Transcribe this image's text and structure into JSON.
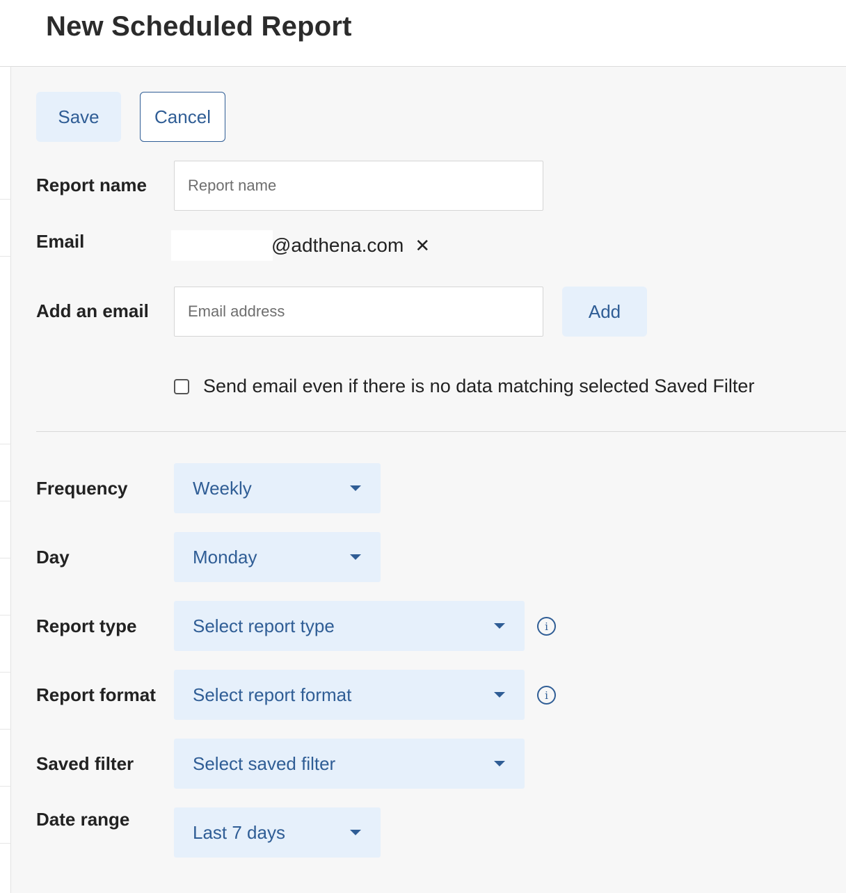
{
  "header": {
    "title": "New Scheduled Report"
  },
  "actions": {
    "save_label": "Save",
    "cancel_label": "Cancel"
  },
  "form": {
    "report_name": {
      "label": "Report name",
      "value": "",
      "placeholder": "Report name"
    },
    "email": {
      "label": "Email",
      "recipient_domain": "@adthena.com",
      "remove_glyph": "✕"
    },
    "add_email": {
      "label": "Add an email",
      "value": "",
      "placeholder": "Email address",
      "button_label": "Add"
    },
    "send_empty": {
      "label": "Send email even if there is no data matching selected Saved Filter",
      "checked": false
    },
    "frequency": {
      "label": "Frequency",
      "value": "Weekly"
    },
    "day": {
      "label": "Day",
      "value": "Monday"
    },
    "report_type": {
      "label": "Report type",
      "value": "Select report type",
      "info_glyph": "i"
    },
    "report_format": {
      "label": "Report format",
      "value": "Select report format",
      "info_glyph": "i"
    },
    "saved_filter": {
      "label": "Saved filter",
      "value": "Select saved filter"
    },
    "date_range": {
      "label": "Date range",
      "value": "Last 7 days"
    }
  },
  "icons": {
    "dropdown": "caret-down-icon",
    "info": "info-circle-icon",
    "remove": "close-icon"
  },
  "colors": {
    "accent": "#2f5d95",
    "button_fill": "#e6f0fb",
    "panel_background": "#f7f7f7",
    "text": "#222222"
  }
}
